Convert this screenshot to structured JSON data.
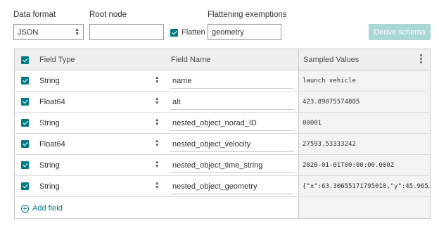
{
  "form": {
    "data_format_label": "Data format",
    "data_format_value": "JSON",
    "root_node_label": "Root node",
    "root_node_value": "",
    "flatten_label": "Flatten",
    "flatten_checked": true,
    "flattening_exemptions_label": "Flattening exemptions",
    "flattening_exemptions_value": "geometry",
    "derive_schema_label": "Derive schema"
  },
  "table": {
    "columns": {
      "field_type": "Field Type",
      "field_name": "Field Name",
      "sampled_values": "Sampled Values"
    },
    "rows": [
      {
        "type": "String",
        "name": "name",
        "sample": "launch vehicle",
        "checked": true
      },
      {
        "type": "Float64",
        "name": "alt",
        "sample": "423.89075574805",
        "checked": true
      },
      {
        "type": "String",
        "name": "nested_object_norad_ID",
        "sample": "00001",
        "checked": true
      },
      {
        "type": "Float64",
        "name": "nested_object_velocity",
        "sample": "27593.53333242",
        "checked": true
      },
      {
        "type": "String",
        "name": "nested_object_time_string",
        "sample": "2020-01-01T00:00:00.000Z",
        "checked": true
      },
      {
        "type": "String",
        "name": "nested_object_geometry",
        "sample": "{\"x\":63.30655171795018,\"y\":45.965…",
        "checked": true
      }
    ],
    "add_field_label": "Add field"
  },
  "colors": {
    "accent": "#007a84",
    "button_disabled": "#a9d7d4",
    "header_bg": "#efefef"
  }
}
